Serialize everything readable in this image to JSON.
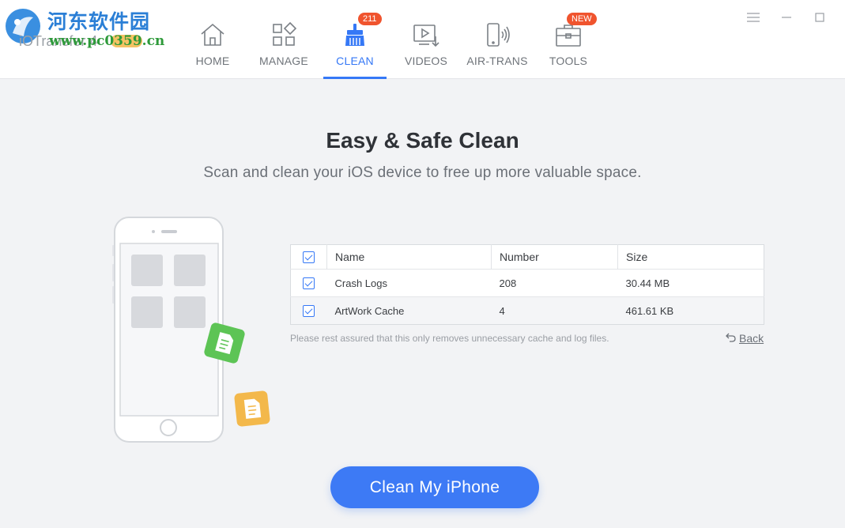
{
  "logo": {
    "watermark_text": "河东软件园",
    "app_name": "iOTransfer 4",
    "watermark_url": "www.pc0359.cn"
  },
  "nav": {
    "items": [
      {
        "label": "HOME",
        "icon": "home-icon",
        "active": false
      },
      {
        "label": "MANAGE",
        "icon": "grid-icon",
        "active": false
      },
      {
        "label": "CLEAN",
        "icon": "broom-icon",
        "active": true,
        "badge": "211"
      },
      {
        "label": "VIDEOS",
        "icon": "video-download-icon",
        "active": false
      },
      {
        "label": "AIR-TRANS",
        "icon": "wireless-phone-icon",
        "active": false
      },
      {
        "label": "TOOLS",
        "icon": "toolbox-icon",
        "active": false,
        "badge": "NEW"
      }
    ]
  },
  "window_controls": [
    "menu-icon",
    "minimize-icon",
    "maximize-icon"
  ],
  "main": {
    "title": "Easy & Safe Clean",
    "subtitle": "Scan and clean your iOS device to free up more valuable space."
  },
  "table": {
    "columns": [
      "Name",
      "Number",
      "Size"
    ],
    "select_all_checked": true,
    "rows": [
      {
        "checked": true,
        "name": "Crash Logs",
        "number": "208",
        "size": "30.44 MB"
      },
      {
        "checked": true,
        "name": "ArtWork Cache",
        "number": "4",
        "size": "461.61 KB"
      }
    ]
  },
  "note": "Please rest assured that this only removes unnecessary cache and log files.",
  "back_label": "Back",
  "cta_label": "Clean My iPhone",
  "colors": {
    "accent": "#3578f6",
    "badge": "#f0542e",
    "background": "#f2f3f5",
    "cta": "#3d7af5"
  }
}
